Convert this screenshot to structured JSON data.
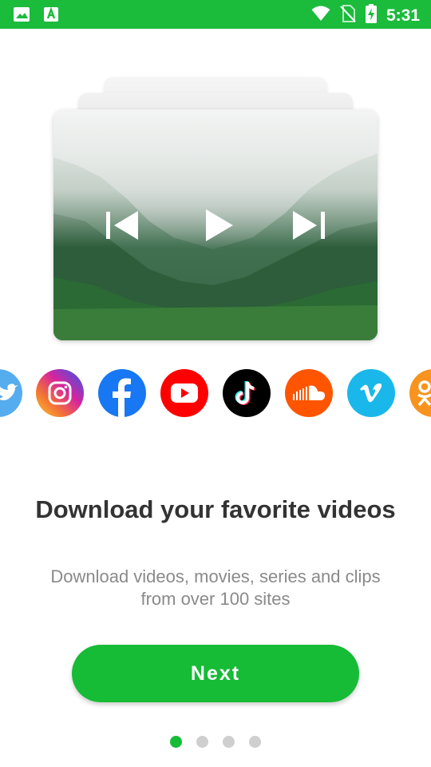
{
  "status_bar": {
    "time": "5:31",
    "icons": [
      "image-icon",
      "app-a-icon",
      "wifi-icon",
      "no-sim-icon",
      "battery-charging-icon"
    ]
  },
  "player": {
    "controls": [
      "skip-previous-icon",
      "play-icon",
      "skip-next-icon"
    ]
  },
  "social_sites": [
    {
      "name": "twitter-icon",
      "color": "#55acee"
    },
    {
      "name": "instagram-icon",
      "color": "#d6249f"
    },
    {
      "name": "facebook-icon",
      "color": "#1877f2"
    },
    {
      "name": "youtube-icon",
      "color": "#ff0000"
    },
    {
      "name": "tiktok-icon",
      "color": "#000000"
    },
    {
      "name": "soundcloud-icon",
      "color": "#ff5500"
    },
    {
      "name": "vimeo-icon",
      "color": "#1ab7ea"
    },
    {
      "name": "odnoklassniki-icon",
      "color": "#f7931e"
    }
  ],
  "onboarding": {
    "title": "Download your favorite videos",
    "subtitle_line1": "Download videos, movies, series and clips",
    "subtitle_line2": "from over 100 sites",
    "next_label": "Next",
    "page_count": 4,
    "current_page": 1
  },
  "colors": {
    "accent": "#16bb36",
    "status_bar": "#1bbb3b",
    "dot_inactive": "#cfcfcf"
  }
}
